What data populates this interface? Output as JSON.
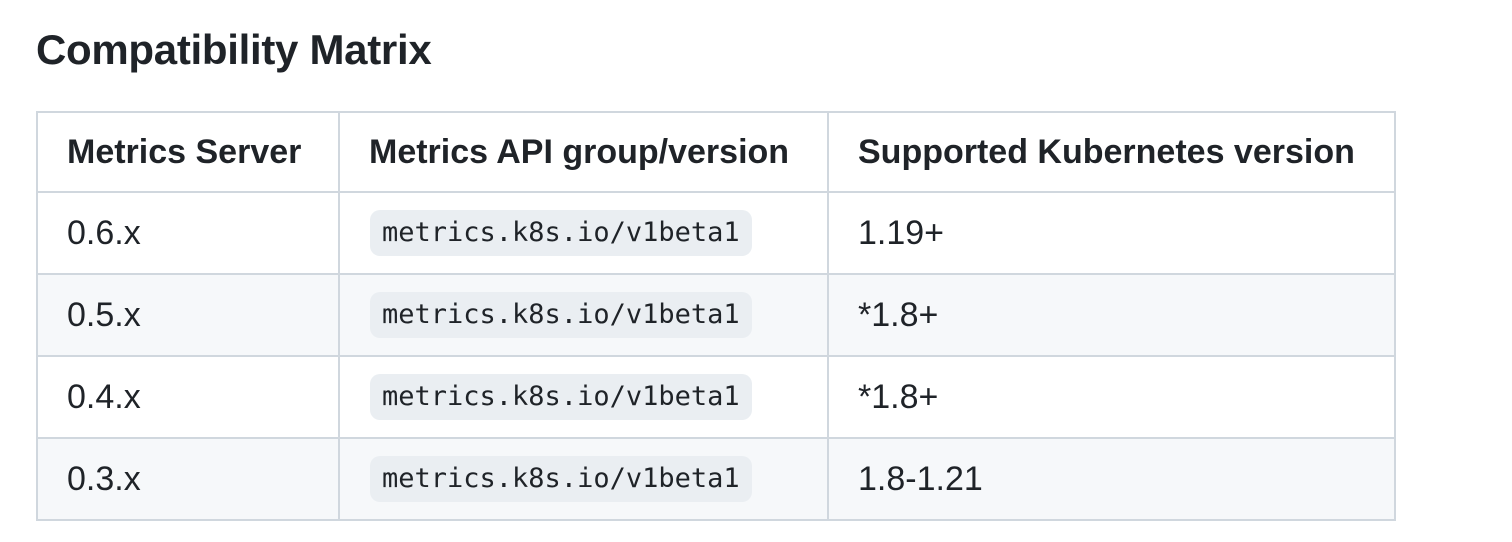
{
  "heading": "Compatibility Matrix",
  "table": {
    "headers": [
      "Metrics Server",
      "Metrics API group/version",
      "Supported Kubernetes version"
    ],
    "rows": [
      [
        "0.6.x",
        "metrics.k8s.io/v1beta1",
        "1.19+"
      ],
      [
        "0.5.x",
        "metrics.k8s.io/v1beta1",
        "*1.8+"
      ],
      [
        "0.4.x",
        "metrics.k8s.io/v1beta1",
        "*1.8+"
      ],
      [
        "0.3.x",
        "metrics.k8s.io/v1beta1",
        "1.8-1.21"
      ]
    ]
  },
  "colors": {
    "text": "#1f2328",
    "border": "#d0d7de",
    "striped_row": "#f6f8fa",
    "code_background": "#eaeef2"
  }
}
